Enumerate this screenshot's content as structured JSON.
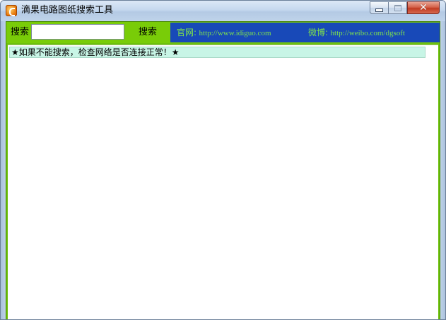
{
  "window": {
    "title": "滴果电路图纸搜索工具",
    "icon": "app-logo-icon"
  },
  "toolbar": {
    "search_label": "搜索",
    "search_value": "",
    "search_button": "搜索",
    "links": {
      "official_label": "官网:",
      "official_url": "http://www.idiguo.com",
      "weibo_label": "微博:",
      "weibo_url": "http://weibo.com/dgsoft"
    }
  },
  "content": {
    "notice": "★如果不能搜索，检查网络是否连接正常！★"
  },
  "colors": {
    "toolbar_green": "#79cc08",
    "link_bar_blue": "#1849b8",
    "link_text_green": "#7ee14c",
    "notice_bg": "#c8f5e6"
  }
}
